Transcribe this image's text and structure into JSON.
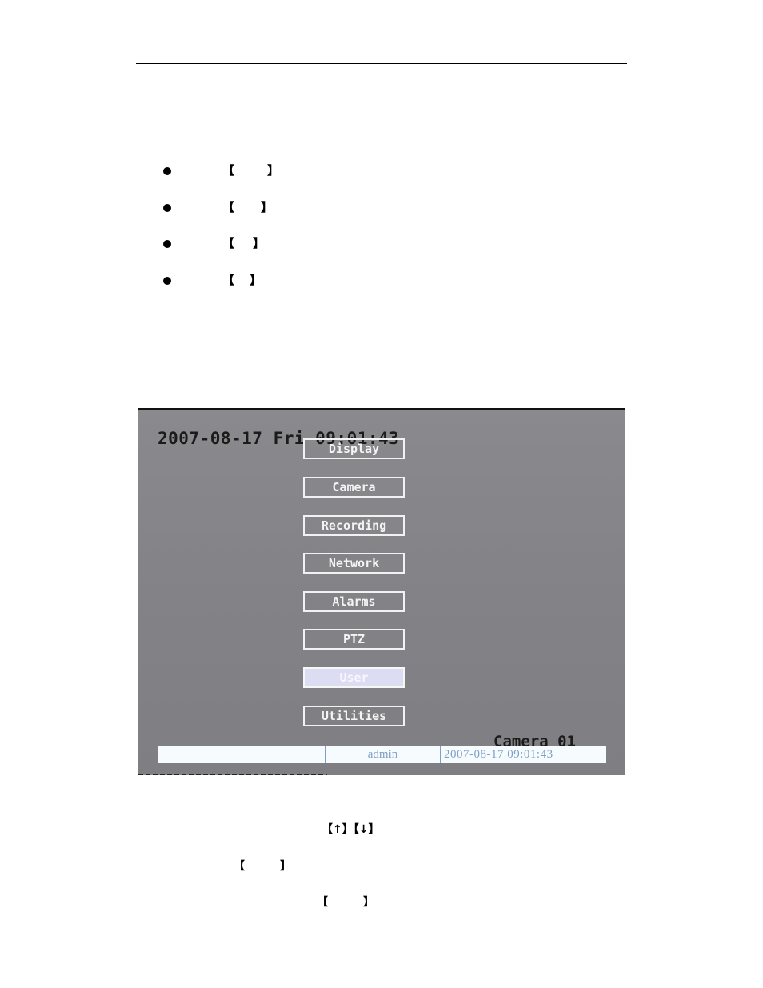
{
  "page": {
    "bullets": [
      {
        "open": "【",
        "close": "】"
      },
      {
        "open": "【",
        "close": "】"
      },
      {
        "open": "【",
        "close": "】"
      },
      {
        "open": "【",
        "close": "】"
      }
    ],
    "instructions": {
      "keys_line": "【↑】【↓】",
      "line2_open": "【",
      "line2_close": "】",
      "line3_open": "【",
      "line3_close": "】"
    }
  },
  "dvr_screen": {
    "osd_datetime": "2007-08-17 Fri 09:01:43",
    "camera_label": "Camera 01",
    "menu_items": [
      {
        "label": "Display",
        "selected": false
      },
      {
        "label": "Camera",
        "selected": false
      },
      {
        "label": "Recording",
        "selected": false
      },
      {
        "label": "Network",
        "selected": false
      },
      {
        "label": "Alarms",
        "selected": false
      },
      {
        "label": "PTZ",
        "selected": false
      },
      {
        "label": "User",
        "selected": true
      },
      {
        "label": "Utilities",
        "selected": false
      }
    ],
    "status_bar": {
      "field1": "",
      "user": "admin",
      "datetime": "2007-08-17 09:01:43"
    }
  }
}
